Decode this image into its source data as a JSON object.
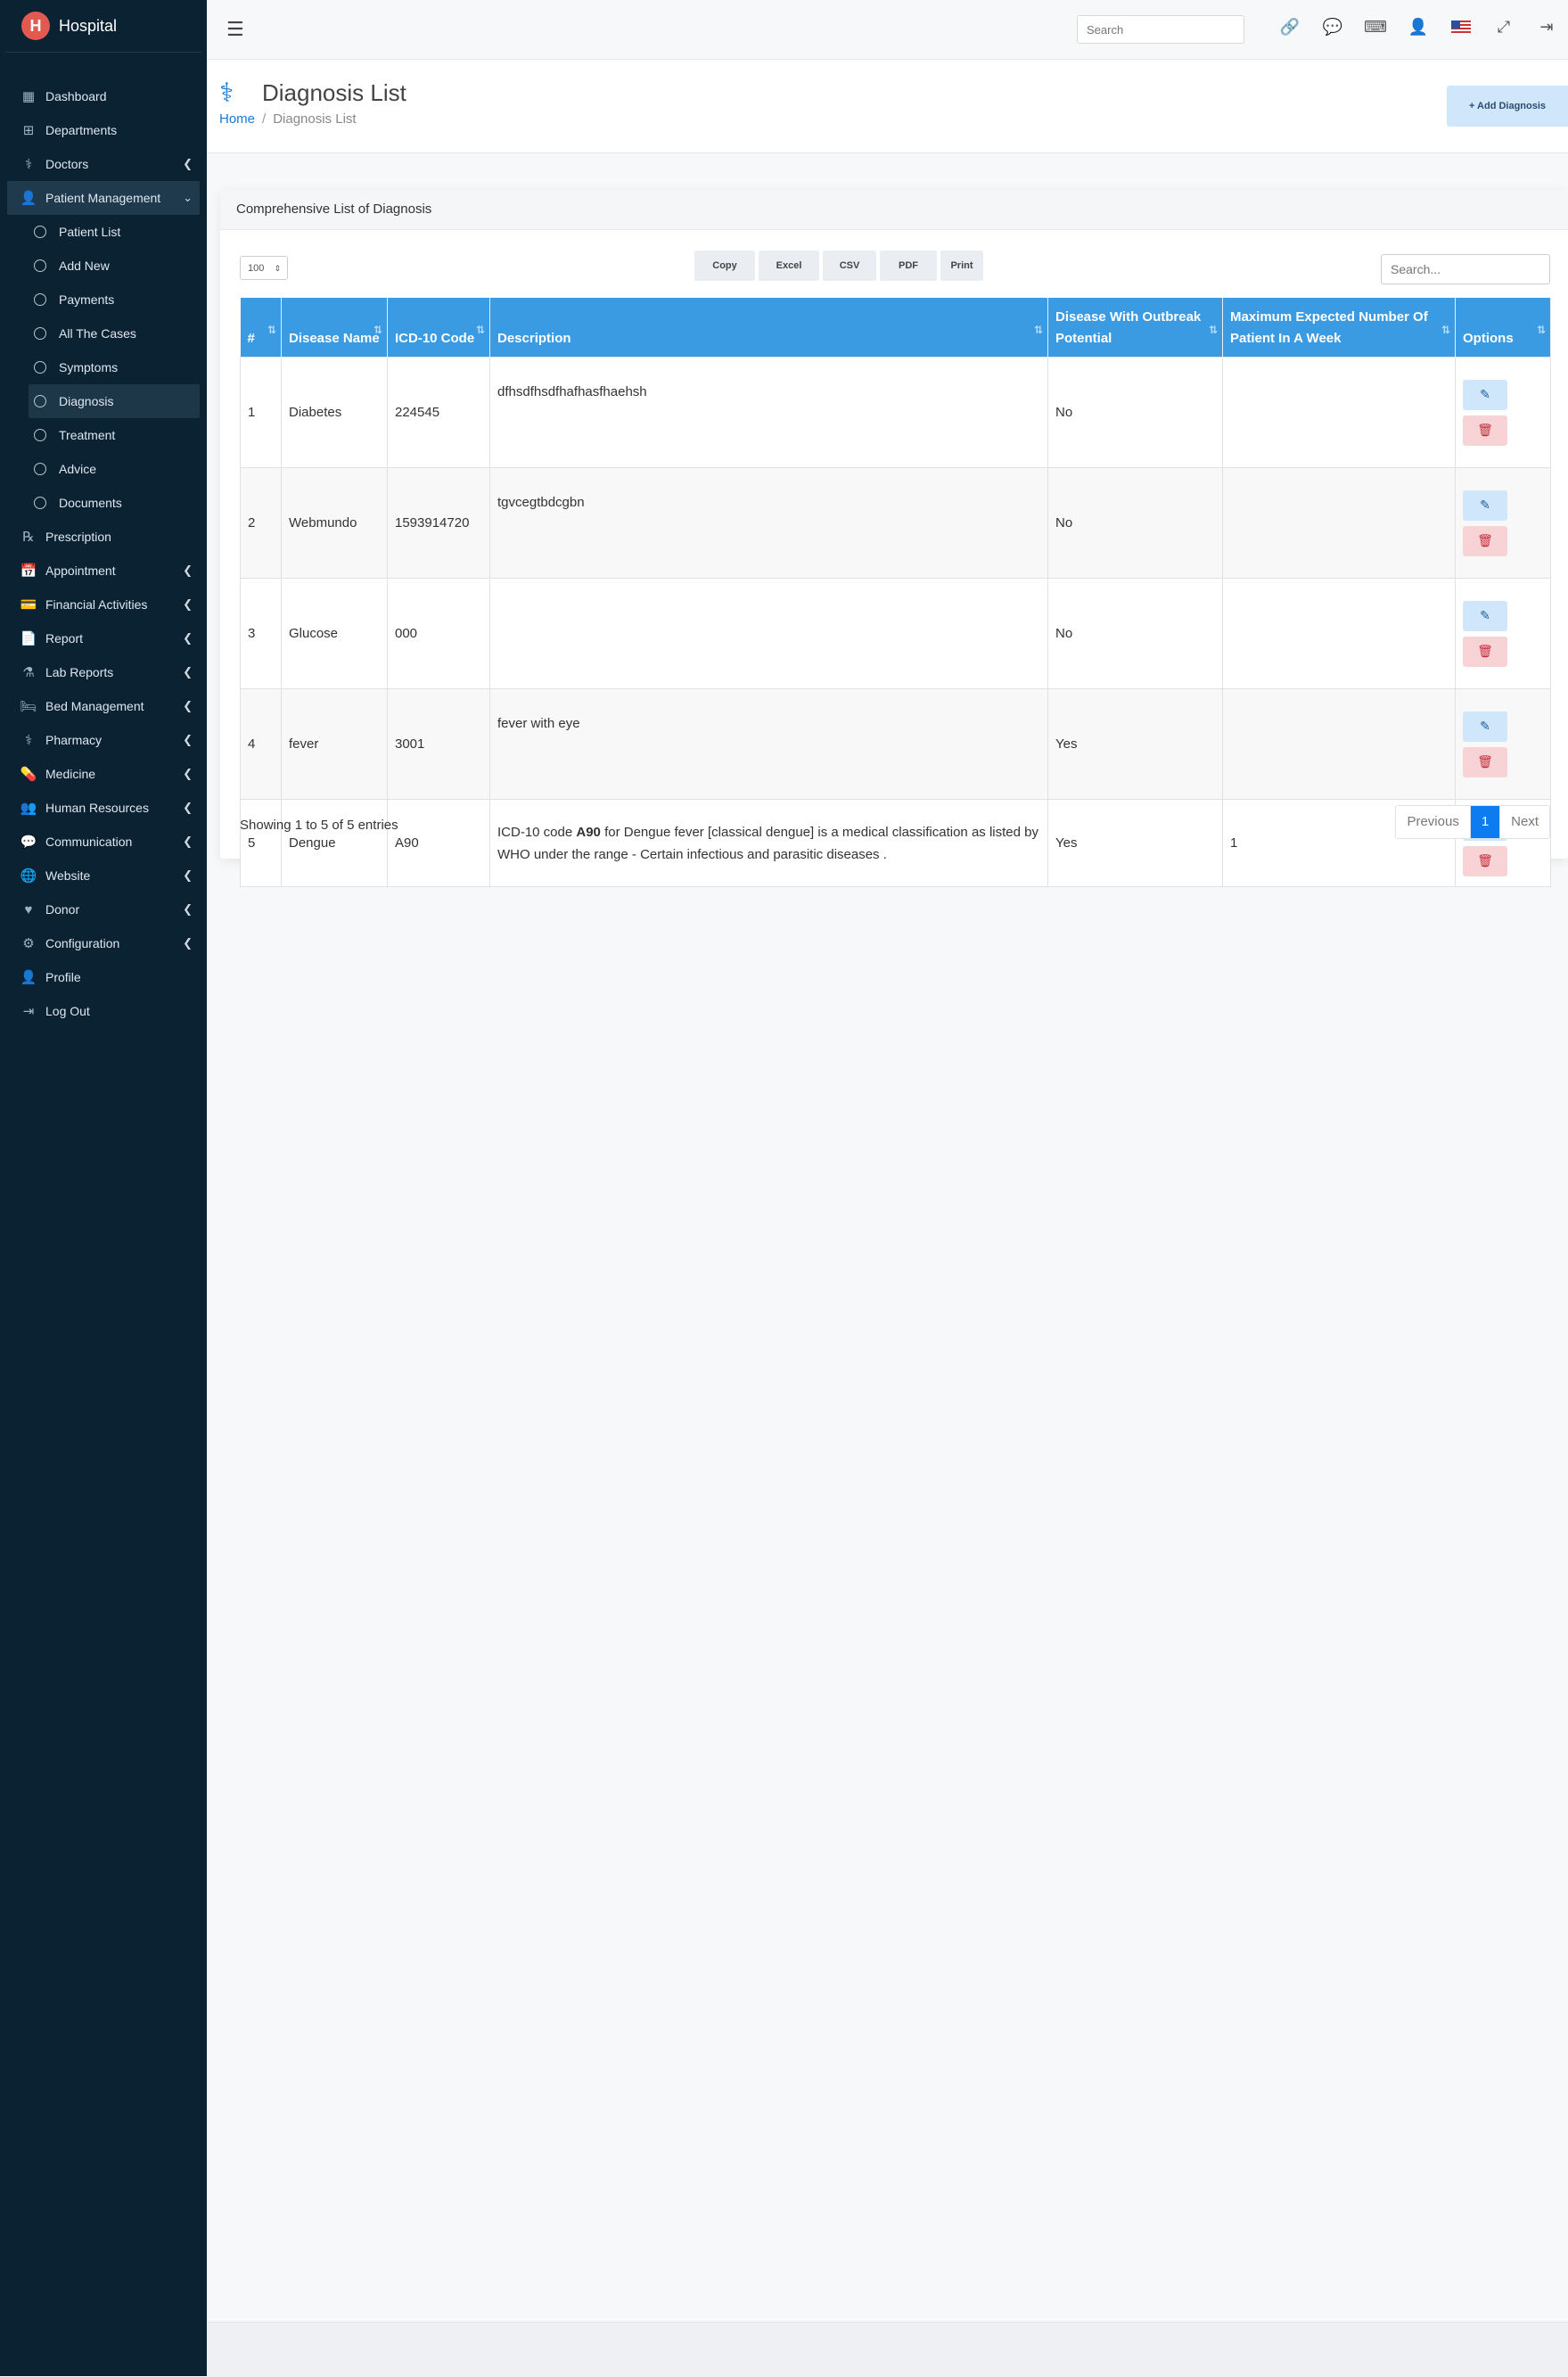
{
  "brand": {
    "logo": "H",
    "name": "Hospital"
  },
  "sidebar": {
    "items": [
      {
        "label": "Dashboard",
        "icon": "grid-icon",
        "glyph": "▦"
      },
      {
        "label": "Departments",
        "icon": "sitemap-icon",
        "glyph": "⊞"
      },
      {
        "label": "Doctors",
        "icon": "user-md-icon",
        "glyph": "⚕"
      },
      {
        "label": "Patient Management",
        "icon": "user-icon",
        "glyph": "👤"
      },
      {
        "label": "Prescription",
        "icon": "prescription-icon",
        "glyph": "℞"
      },
      {
        "label": "Appointment",
        "icon": "calendar-icon",
        "glyph": "📅"
      },
      {
        "label": "Financial Activities",
        "icon": "money-icon",
        "glyph": "💳"
      },
      {
        "label": "Report",
        "icon": "file-icon",
        "glyph": "📄"
      },
      {
        "label": "Lab Reports",
        "icon": "flask-icon",
        "glyph": "⚗"
      },
      {
        "label": "Bed Management",
        "icon": "bed-icon",
        "glyph": "🛏"
      },
      {
        "label": "Pharmacy",
        "icon": "pharmacy-icon",
        "glyph": "⚕"
      },
      {
        "label": "Medicine",
        "icon": "medkit-icon",
        "glyph": "💊"
      },
      {
        "label": "Human Resources",
        "icon": "users-icon",
        "glyph": "👥"
      },
      {
        "label": "Communication",
        "icon": "comments-icon",
        "glyph": "💬"
      },
      {
        "label": "Website",
        "icon": "globe-icon",
        "glyph": "🌐"
      },
      {
        "label": "Donor",
        "icon": "donor-icon",
        "glyph": "♥"
      },
      {
        "label": "Configuration",
        "icon": "gear-icon",
        "glyph": "⚙"
      },
      {
        "label": "Profile",
        "icon": "user-icon",
        "glyph": "👤"
      },
      {
        "label": "Log Out",
        "icon": "logout-icon",
        "glyph": "⇥"
      }
    ],
    "sub_items": [
      "Patient List",
      "Add New",
      "Payments",
      "All The Cases",
      "Symptoms",
      "Diagnosis",
      "Treatment",
      "Advice",
      "Documents"
    ]
  },
  "topbar": {
    "search_placeholder": "Search",
    "icons": [
      "link-icon",
      "chat-icon",
      "keyboard-icon",
      "user-icon",
      "us-flag-icon",
      "expand-icon",
      "logout-icon"
    ]
  },
  "page": {
    "title": "Diagnosis List",
    "breadcrumb_home": "Home",
    "breadcrumb_current": "Diagnosis List",
    "add_button": "+ Add Diagnosis"
  },
  "card": {
    "title": "Comprehensive List of Diagnosis",
    "page_length": "100",
    "export_buttons": [
      "Copy",
      "Excel",
      "CSV",
      "PDF",
      "Print"
    ],
    "search_placeholder": "Search...",
    "columns": [
      "#",
      "Disease Name",
      "ICD-10 Code",
      "Description",
      "Disease With Outbreak Potential",
      "Maximum Expected Number Of Patient In A Week",
      "Options"
    ],
    "rows": [
      {
        "num": "1",
        "name": "Diabetes",
        "code": "224545",
        "desc": "dfhsdfhsdfhafhasfhaehsh",
        "outbreak": "No",
        "max": ""
      },
      {
        "num": "2",
        "name": "Webmundo",
        "code": "1593914720",
        "desc": "tgvcegtbdcgbn",
        "outbreak": "No",
        "max": ""
      },
      {
        "num": "3",
        "name": "Glucose",
        "code": "000",
        "desc": "",
        "outbreak": "No",
        "max": ""
      },
      {
        "num": "4",
        "name": "fever",
        "code": "3001",
        "desc": "fever with eye",
        "outbreak": "Yes",
        "max": ""
      },
      {
        "num": "5",
        "name": "Dengue",
        "code": "A90",
        "desc_pre": "ICD-10 code ",
        "desc_bold": "A90",
        "desc_post": " for Dengue fever [classical dengue] is a medical classification as listed by WHO under the range - Certain infectious and parasitic diseases .",
        "outbreak": "Yes",
        "max": "1"
      }
    ],
    "info": "Showing 1 to 5 of 5 entries",
    "pager": {
      "prev": "Previous",
      "current": "1",
      "next": "Next"
    }
  }
}
